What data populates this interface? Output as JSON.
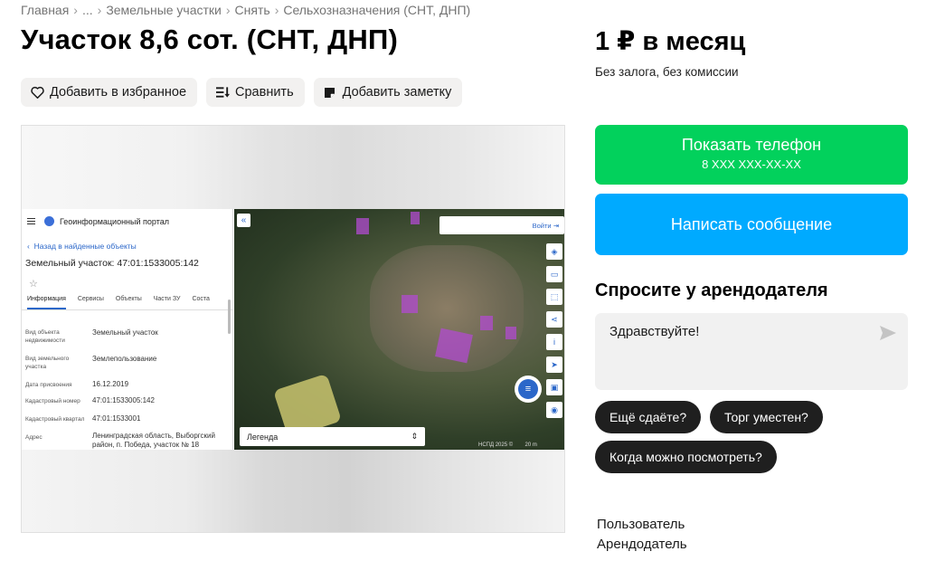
{
  "breadcrumb": [
    "Главная",
    "...",
    "Земельные участки",
    "Снять",
    "Сельхозназначения (СНТ, ДНП)"
  ],
  "title": "Участок 8,6 сот. (СНТ, ДНП)",
  "actions": {
    "favorite": "Добавить в избранное",
    "compare": "Сравнить",
    "note": "Добавить заметку"
  },
  "photo": {
    "portal_title": "Геоинформационный портал",
    "back_link": "Назад в найденные объекты",
    "object_title": "Земельный участок: 47:01:1533005:142",
    "tabs": [
      "Информация",
      "Сервисы",
      "Объекты",
      "Части ЗУ",
      "Соста"
    ],
    "fields": [
      {
        "label": "Вид объекта недвижимости",
        "value": "Земельный участок"
      },
      {
        "label": "Вид земельного участка",
        "value": "Землепользование"
      },
      {
        "label": "Дата присвоения",
        "value": "16.12.2019"
      },
      {
        "label": "Кадастровый номер",
        "value": "47:01:1533005:142"
      },
      {
        "label": "Кадастровый квартал",
        "value": "47:01:1533001"
      },
      {
        "label": "Адрес",
        "value": "Ленинградская область, Выборгский район, п. Победа, участок № 18"
      }
    ],
    "login_label": "Войти",
    "legend_label": "Легенда",
    "map_copyright": "НСПД 2025 ©",
    "scale_label": "20 m"
  },
  "price": "1 ₽ в месяц",
  "terms": "Без залога, без комиссии",
  "phone_button": {
    "label": "Показать телефон",
    "number": "8 XXX XXX-XX-XX"
  },
  "message_button": "Написать сообщение",
  "ask": {
    "title": "Спросите у арендодателя",
    "input_value": "Здравствуйте!",
    "chips": [
      "Ещё сдаёте?",
      "Торг уместен?",
      "Когда можно посмотреть?"
    ]
  },
  "seller": {
    "line1": "Пользователь",
    "line2": "Арендодатель"
  },
  "colors": {
    "green": "#02d15c",
    "blue": "#00aaff",
    "chip": "#1f1f1f",
    "plot": "#b24bd0"
  }
}
